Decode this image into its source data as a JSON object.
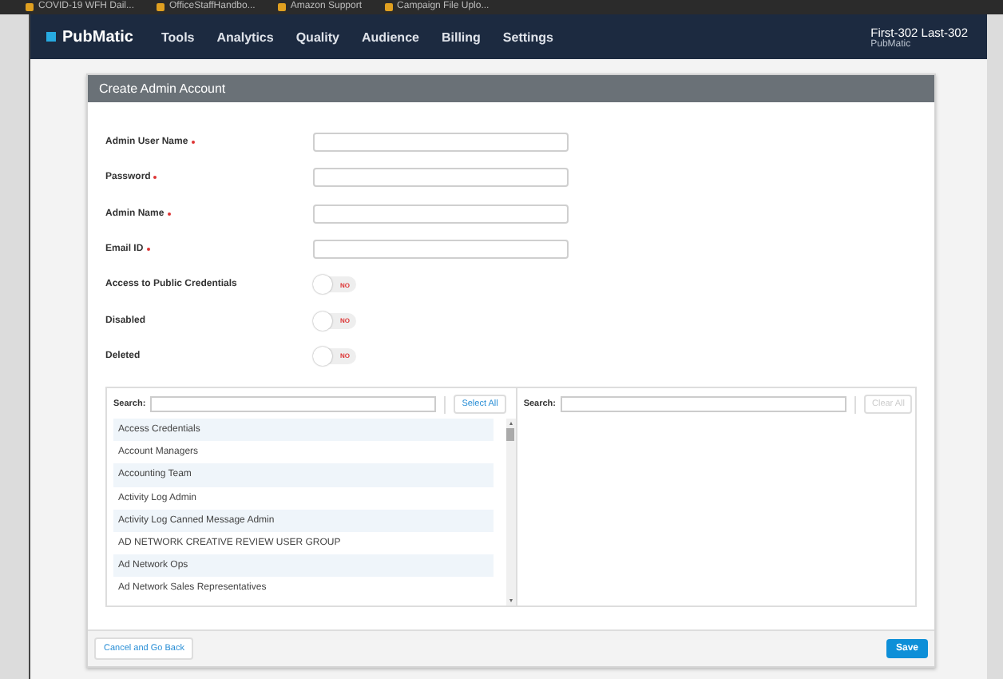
{
  "bookmarks": [
    "COVID-19 WFH Dail...",
    "OfficeStaffHandbo...",
    "Amazon Support",
    "Campaign File Uplo..."
  ],
  "brand": "PubMatic",
  "nav": [
    "Tools",
    "Analytics",
    "Quality",
    "Audience",
    "Billing",
    "Settings"
  ],
  "user": {
    "name": "First-302 Last-302",
    "org": "PubMatic"
  },
  "panel": {
    "title": "Create Admin Account"
  },
  "fields": [
    {
      "label": "Admin User Name",
      "required": true,
      "kind": "text"
    },
    {
      "label": "Password",
      "required": true,
      "kind": "text"
    },
    {
      "label": "Admin Name",
      "required": true,
      "kind": "text"
    },
    {
      "label": "Email ID",
      "required": true,
      "kind": "text"
    },
    {
      "label": "Access to Public Credentials",
      "required": false,
      "kind": "toggle",
      "on": false,
      "state_text": "NO"
    },
    {
      "label": "Disabled",
      "required": false,
      "kind": "toggle",
      "on": false,
      "state_text": "NO"
    },
    {
      "label": "Deleted",
      "required": false,
      "kind": "toggle",
      "on": false,
      "state_text": "NO"
    }
  ],
  "available": {
    "search_label": "Search:",
    "button": "Select All",
    "button_disabled": false,
    "items": [
      {
        "label": "Access Credentials"
      },
      {
        "label": "Account Managers"
      },
      {
        "label": "Accounting Team"
      },
      {
        "label": "Activity Log Admin"
      },
      {
        "label": "Activity Log Canned Message Admin"
      },
      {
        "label": "AD NETWORK CREATIVE REVIEW USER GROUP"
      },
      {
        "label": "Ad Network Ops"
      },
      {
        "label": "Ad Network Sales Representatives"
      }
    ]
  },
  "chosen": {
    "search_label": "Search:",
    "button": "Clear All",
    "button_disabled": true
  },
  "footer": {
    "cancel": "Cancel and Go Back",
    "save": "Save"
  }
}
